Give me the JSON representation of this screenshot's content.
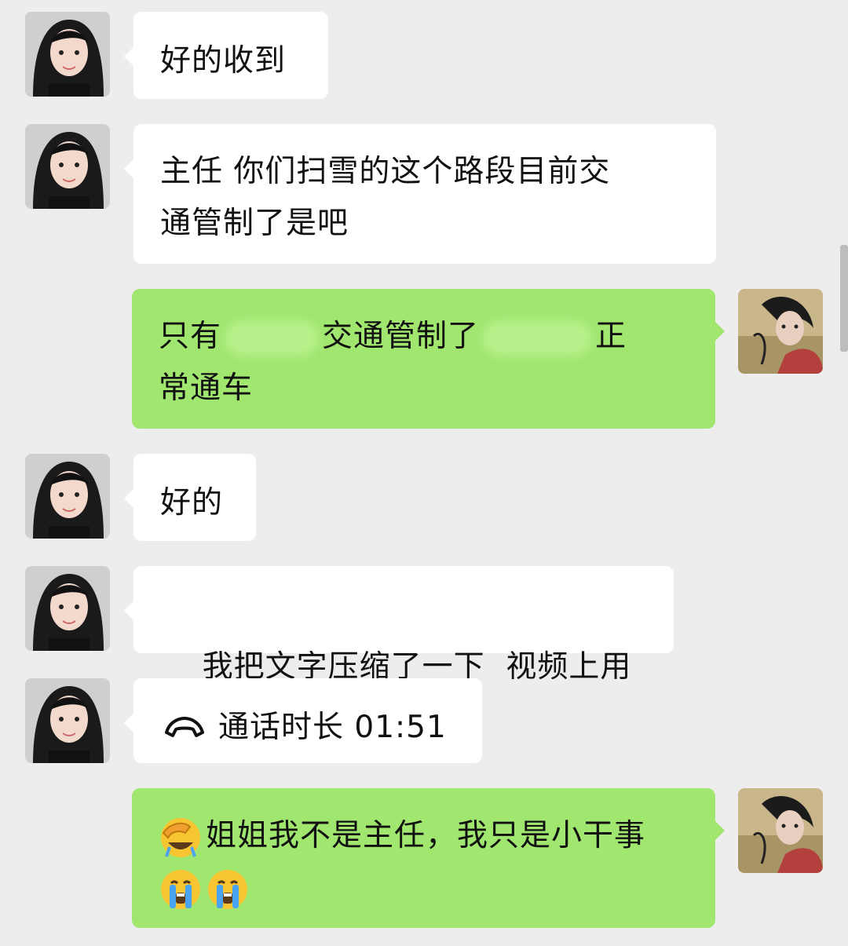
{
  "messages": [
    {
      "side": "in",
      "text": "好的收到"
    },
    {
      "side": "in",
      "lines": [
        "主任 你们扫雪的这个路段目前交",
        "通管制了是吧"
      ]
    },
    {
      "side": "out",
      "parts": [
        "只有",
        "交通管制了",
        "正"
      ],
      "line2": "常通车"
    },
    {
      "side": "in",
      "text": "好的"
    },
    {
      "side": "in",
      "text": "我把文字压缩了一下  视频上用"
    },
    {
      "side": "in",
      "call_icon": "phone-hangup-icon",
      "call_text": "通话时长 01:51"
    },
    {
      "side": "out",
      "emoji_first": "face-palm-emoji",
      "text": "姐姐我不是主任，我只是小干事",
      "emoji_line2": [
        "crying-emoji",
        "crying-emoji"
      ]
    }
  ],
  "colors": {
    "background": "#ededed",
    "incoming_bubble": "#ffffff",
    "outgoing_bubble": "#a0e66f"
  }
}
